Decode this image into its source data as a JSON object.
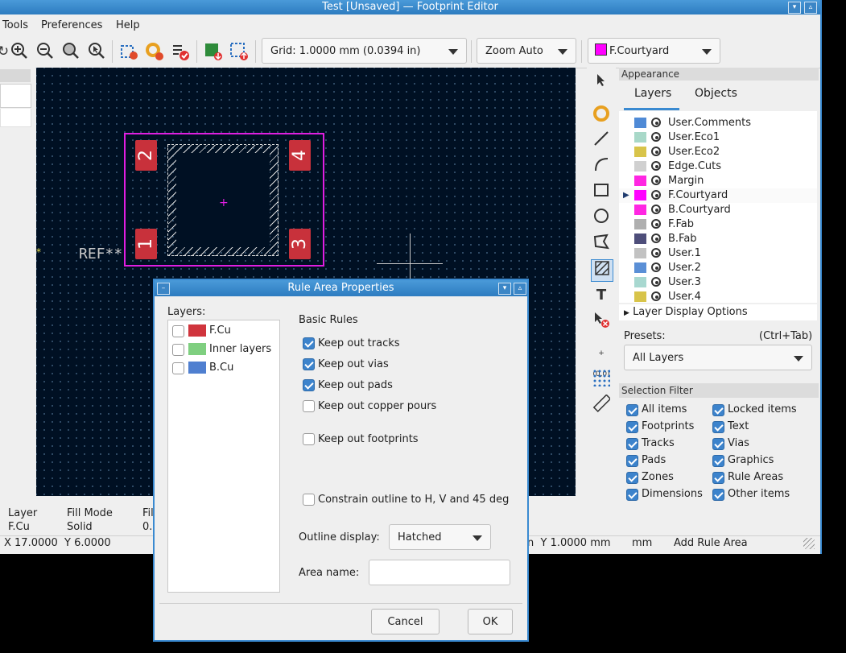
{
  "window": {
    "title": "Test [Unsaved] — Footprint Editor"
  },
  "menu": {
    "items": [
      "Tools",
      "Preferences",
      "Help"
    ]
  },
  "toolbar": {
    "grid": "Grid: 1.0000 mm (0.0394 in)",
    "zoom": "Zoom Auto",
    "layer": "F.Courtyard",
    "layer_color": "#ff00ff"
  },
  "canvas": {
    "ref_text": "REF**",
    "pads": [
      "2",
      "4",
      "1",
      "3"
    ],
    "background": "#001023"
  },
  "appearance": {
    "header": "Appearance",
    "tabs": [
      "Layers",
      "Objects"
    ],
    "layers": [
      {
        "name": "User.Comments",
        "color": "#4f8ad6"
      },
      {
        "name": "User.Eco1",
        "color": "#a8d8c8"
      },
      {
        "name": "User.Eco2",
        "color": "#d8c44a"
      },
      {
        "name": "Edge.Cuts",
        "color": "#d0d0d0"
      },
      {
        "name": "Margin",
        "color": "#ff26e2"
      },
      {
        "name": "F.Courtyard",
        "color": "#ff00ff",
        "active": true
      },
      {
        "name": "B.Courtyard",
        "color": "#ff26e2"
      },
      {
        "name": "F.Fab",
        "color": "#afafaf"
      },
      {
        "name": "B.Fab",
        "color": "#4e4e7a"
      },
      {
        "name": "User.1",
        "color": "#c2c2c2"
      },
      {
        "name": "User.2",
        "color": "#5a8fd6"
      },
      {
        "name": "User.3",
        "color": "#a8d8d0"
      },
      {
        "name": "User.4",
        "color": "#d8c44a"
      }
    ],
    "layer_display_options": "Layer Display Options",
    "presets_label": "Presets:",
    "presets_shortcut": "(Ctrl+Tab)",
    "presets_value": "All Layers"
  },
  "selection_filter": {
    "header": "Selection Filter",
    "items": [
      {
        "label": "All items",
        "checked": true
      },
      {
        "label": "Locked items",
        "checked": true
      },
      {
        "label": "Footprints",
        "checked": true
      },
      {
        "label": "Text",
        "checked": true
      },
      {
        "label": "Tracks",
        "checked": true
      },
      {
        "label": "Vias",
        "checked": true
      },
      {
        "label": "Pads",
        "checked": true
      },
      {
        "label": "Graphics",
        "checked": true
      },
      {
        "label": "Zones",
        "checked": true
      },
      {
        "label": "Rule Areas",
        "checked": true
      },
      {
        "label": "Dimensions",
        "checked": true
      },
      {
        "label": "Other items",
        "checked": true
      }
    ]
  },
  "status": {
    "col_headers": [
      "Layer",
      "Fill Mode",
      "Fil"
    ],
    "col_values": [
      "F.Cu",
      "Solid",
      "0."
    ],
    "xy": "X 17.0000  Y 6.0000",
    "right_y": "n  Y 1.0000 mm",
    "units": "mm",
    "mode": "Add Rule Area"
  },
  "dialog": {
    "title": "Rule Area Properties",
    "layers_label": "Layers:",
    "layers": [
      {
        "name": "F.Cu",
        "color": "#d0353d"
      },
      {
        "name": "Inner layers",
        "color": "#7fcf80"
      },
      {
        "name": "B.Cu",
        "color": "#4f7fd0"
      }
    ],
    "basic_rules": "Basic Rules",
    "rules": [
      {
        "label": "Keep out tracks",
        "checked": true
      },
      {
        "label": "Keep out vias",
        "checked": true
      },
      {
        "label": "Keep out pads",
        "checked": true
      },
      {
        "label": "Keep out copper pours",
        "checked": false
      },
      {
        "label": "Keep out footprints",
        "checked": false
      }
    ],
    "constrain_outline": "Constrain outline to H, V and 45 deg",
    "outline_display_label": "Outline display:",
    "outline_display_value": "Hatched",
    "area_name_label": "Area name:",
    "area_name_value": "",
    "cancel": "Cancel",
    "ok": "OK"
  }
}
